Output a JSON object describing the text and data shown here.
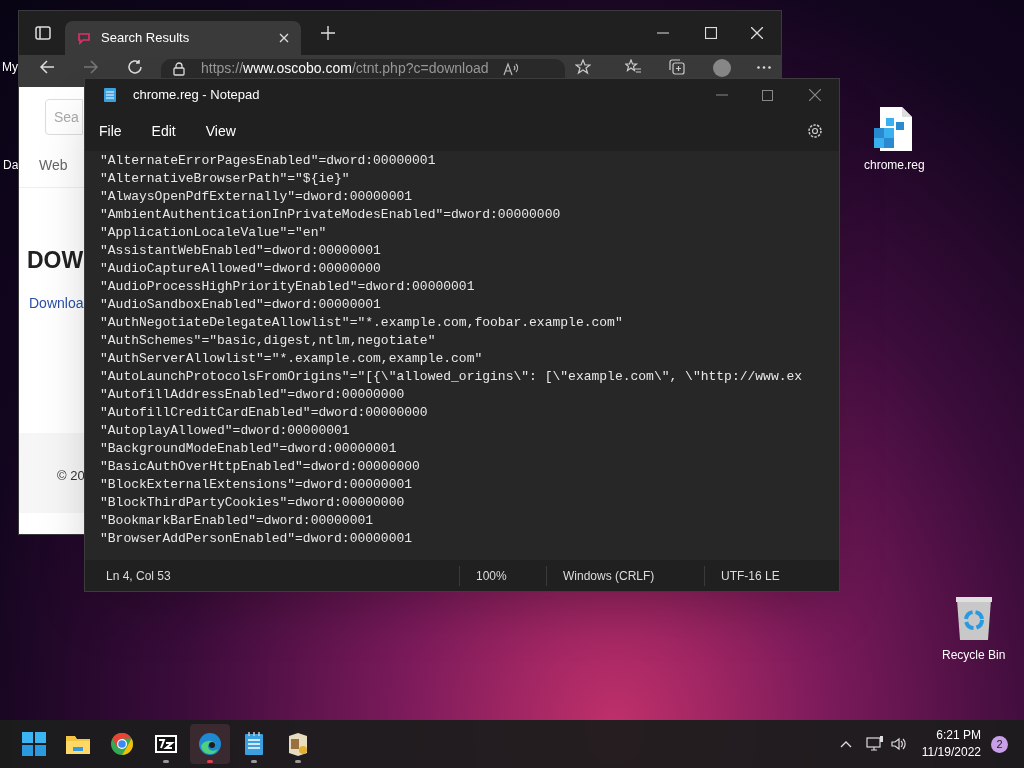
{
  "desktop_icons": [
    {
      "kind": "partial",
      "label": "My"
    },
    {
      "kind": "partial",
      "label": "Da"
    },
    {
      "kind": "registry-file",
      "label": "chrome.reg"
    },
    {
      "kind": "recycle-bin",
      "label": "Recycle Bin"
    }
  ],
  "browser": {
    "tab_title": "Search Results",
    "url_prefix": "https://",
    "url_host": "www.oscobo.com",
    "url_path": "/ctnt.php?c=download",
    "page": {
      "search_placeholder": "Sea",
      "nav_tab": "Web",
      "heading": "DOW",
      "link": "Downloa",
      "footer": "© 20"
    }
  },
  "notepad": {
    "title": "chrome.reg - Notepad",
    "menu": [
      "File",
      "Edit",
      "View"
    ],
    "lines": [
      "\"AlternateErrorPagesEnabled\"=dword:00000001",
      "\"AlternativeBrowserPath\"=\"${ie}\"",
      "\"AlwaysOpenPdfExternally\"=dword:00000001",
      "\"AmbientAuthenticationInPrivateModesEnabled\"=dword:00000000",
      "\"ApplicationLocaleValue\"=\"en\"",
      "\"AssistantWebEnabled\"=dword:00000001",
      "\"AudioCaptureAllowed\"=dword:00000000",
      "\"AudioProcessHighPriorityEnabled\"=dword:00000001",
      "\"AudioSandboxEnabled\"=dword:00000001",
      "\"AuthNegotiateDelegateAllowlist\"=\"*.example.com,foobar.example.com\"",
      "\"AuthSchemes\"=\"basic,digest,ntlm,negotiate\"",
      "\"AuthServerAllowlist\"=\"*.example.com,example.com\"",
      "\"AutoLaunchProtocolsFromOrigins\"=\"[{\\\"allowed_origins\\\": [\\\"example.com\\\", \\\"http://www.ex",
      "\"AutofillAddressEnabled\"=dword:00000000",
      "\"AutofillCreditCardEnabled\"=dword:00000000",
      "\"AutoplayAllowed\"=dword:00000001",
      "\"BackgroundModeEnabled\"=dword:00000001",
      "\"BasicAuthOverHttpEnabled\"=dword:00000000",
      "\"BlockExternalExtensions\"=dword:00000001",
      "\"BlockThirdPartyCookies\"=dword:00000000",
      "\"BookmarkBarEnabled\"=dword:00000001",
      "\"BrowserAddPersonEnabled\"=dword:00000001"
    ],
    "status": [
      "Ln 4, Col 53",
      "100%",
      "Windows (CRLF)",
      "UTF-16 LE"
    ]
  },
  "taskbar": {
    "apps": [
      {
        "kind": "start",
        "running": false,
        "selected": false
      },
      {
        "kind": "folder",
        "running": false,
        "selected": false
      },
      {
        "kind": "chrome",
        "running": false,
        "selected": false
      },
      {
        "kind": "archive",
        "running": true,
        "selected": false
      },
      {
        "kind": "edge",
        "running": true,
        "selected": true
      },
      {
        "kind": "notepad",
        "running": true,
        "selected": false
      },
      {
        "kind": "installer",
        "running": true,
        "selected": false
      }
    ],
    "time": "6:21 PM",
    "date": "11/19/2022",
    "notification_count": "2"
  }
}
